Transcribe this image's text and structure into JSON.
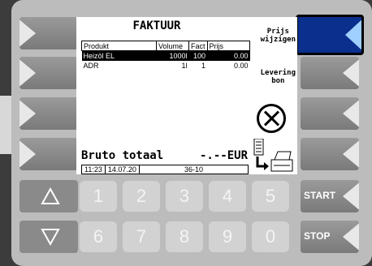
{
  "header": {
    "title": "FAKTUUR"
  },
  "table": {
    "columns": [
      "Produkt",
      "Volume",
      "Fact",
      "Prijs"
    ],
    "rows": [
      {
        "product": "Heizöl EL",
        "volume": "1000l",
        "fact": "100",
        "price": "0.00",
        "selected": true
      },
      {
        "product": "ADR",
        "volume": "1l",
        "fact": "1",
        "price": "0.00",
        "selected": false
      }
    ]
  },
  "softkeys": {
    "right1_line1": "Prijs",
    "right1_line2": "wijzigen",
    "right2_line1": "Levering",
    "right2_line2": "bon"
  },
  "totals": {
    "label": "Bruto totaal",
    "value": "-.--EUR"
  },
  "statusbar": {
    "time": "11:23",
    "date": "14.07.20",
    "code": "36-10"
  },
  "keypad": {
    "keys": [
      "1",
      "2",
      "3",
      "4",
      "5",
      "6",
      "7",
      "8",
      "9",
      "0"
    ],
    "start": "START",
    "stop": "STOP"
  },
  "colors": {
    "active_key": "#0a2f8c",
    "accent": "#9fd0ff"
  }
}
